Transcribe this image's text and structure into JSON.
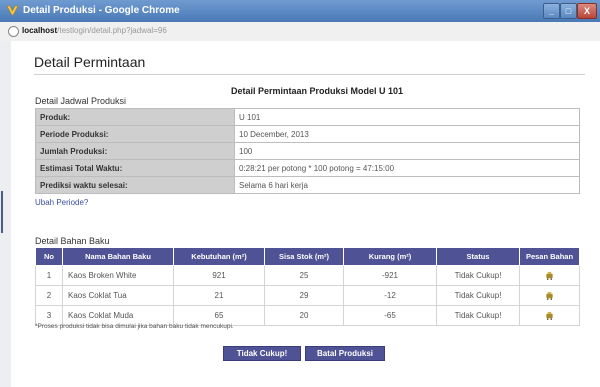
{
  "window": {
    "title": "Detail Produksi - Google Chrome",
    "url_host": "localhost",
    "url_path": "/testlogin/detail.php?jadwal=96",
    "controls": {
      "minimize": "_",
      "maximize": "□",
      "close": "X"
    }
  },
  "page": {
    "title": "Detail Permintaan",
    "heading": "Detail Permintaan Produksi Model U 101"
  },
  "schedule": {
    "section_label": "Detail Jadwal Produksi",
    "rows": [
      {
        "label": "Produk:",
        "value": "U 101"
      },
      {
        "label": "Periode Produksi:",
        "value": "10 December, 2013"
      },
      {
        "label": "Jumlah Produksi:",
        "value": "100"
      },
      {
        "label": "Estimasi Total Waktu:",
        "value": "0:28:21 per potong * 100 potong = 47:15:00"
      },
      {
        "label": "Prediksi waktu selesai:",
        "value": "Selama 6 hari kerja"
      }
    ],
    "change_link": "Ubah Periode?"
  },
  "materials": {
    "section_label": "Detail Bahan Baku",
    "columns": [
      "No",
      "Nama Bahan Baku",
      "Kebutuhan (m²)",
      "Sisa Stok (m²)",
      "Kurang (m²)",
      "Status",
      "Pesan Bahan"
    ],
    "rows": [
      {
        "no": "1",
        "name": "Kaos Broken White",
        "need": "921",
        "stock": "25",
        "short": "-921",
        "status": "Tidak Cukup!",
        "order_icon": "cart-icon"
      },
      {
        "no": "2",
        "name": "Kaos Coklat Tua",
        "need": "21",
        "stock": "29",
        "short": "-12",
        "status": "Tidak Cukup!",
        "order_icon": "cart-icon"
      },
      {
        "no": "3",
        "name": "Kaos Coklat Muda",
        "need": "65",
        "stock": "20",
        "short": "-65",
        "status": "Tidak Cukup!",
        "order_icon": "cart-icon"
      }
    ],
    "note": "*Proses produksi tidak bisa dimulai jika bahan baku tidak mencukupi."
  },
  "buttons": {
    "insufficient": "Tidak Cukup!",
    "cancel": "Batal Produksi"
  },
  "colors": {
    "header_purple": "#4f5294",
    "label_gray": "#cfcfcf",
    "titlebar_blue": "#5a86c0"
  }
}
